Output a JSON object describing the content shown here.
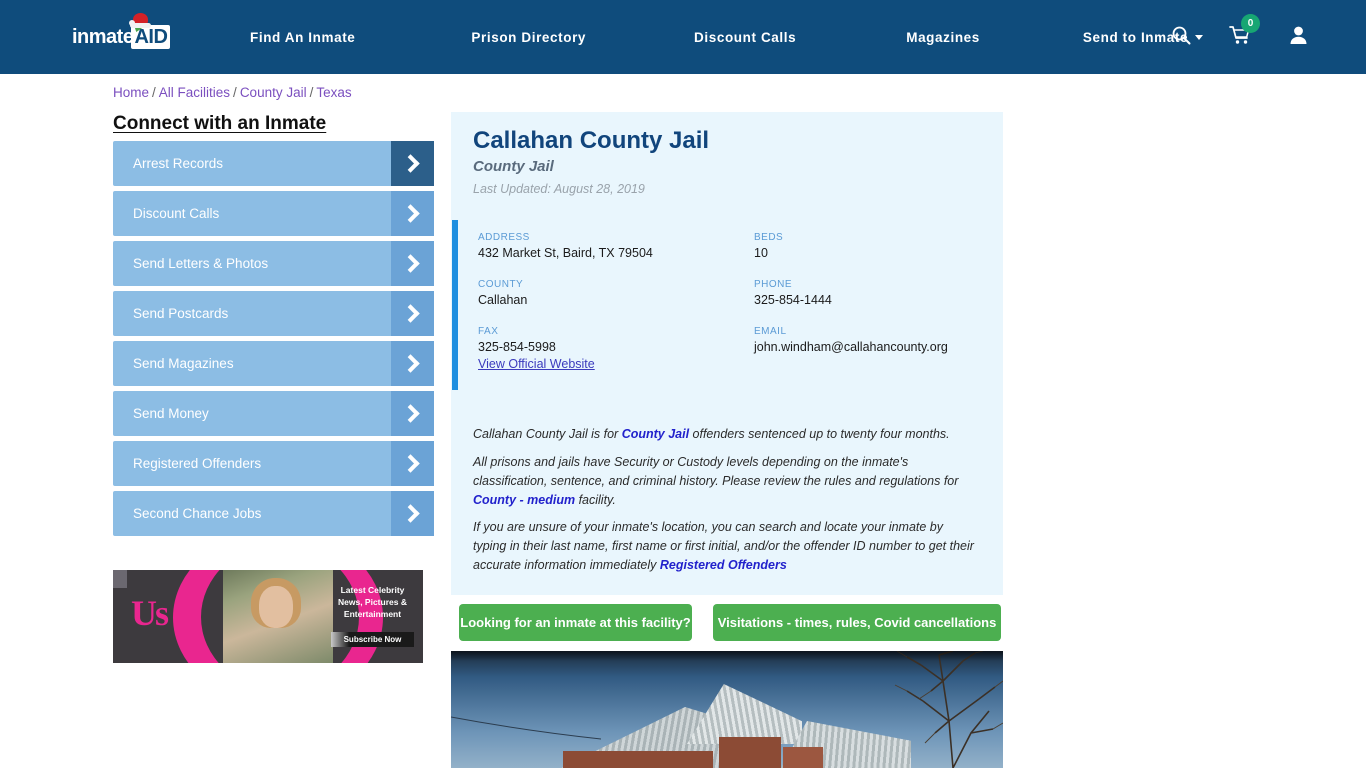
{
  "header": {
    "logo": {
      "text_primary": "inmate",
      "text_secondary": "AID",
      "icon": "santa-hat-icon"
    },
    "nav": [
      {
        "label": "Find An Inmate",
        "has_caret": false
      },
      {
        "label": "Prison Directory",
        "has_caret": false
      },
      {
        "label": "Discount Calls",
        "has_caret": false
      },
      {
        "label": "Magazines",
        "has_caret": false
      },
      {
        "label": "Send to Inmate",
        "has_caret": true
      }
    ],
    "icons": {
      "search": "search-icon",
      "cart": "cart-icon",
      "cart_badge": "0",
      "account": "user-account-icon"
    },
    "colors": {
      "bar_bg": "#0f4c7c",
      "badge_green": "#17a673"
    }
  },
  "breadcrumb": {
    "items": [
      "Home",
      "All Facilities",
      "County Jail",
      "Texas"
    ],
    "separator": "/"
  },
  "sidebar": {
    "title": "Connect with an Inmate",
    "items": [
      {
        "label": "Arrest Records",
        "active": true
      },
      {
        "label": "Discount Calls",
        "active": false
      },
      {
        "label": "Send Letters & Photos",
        "active": false
      },
      {
        "label": "Send Postcards",
        "active": false
      },
      {
        "label": "Send Magazines",
        "active": false
      },
      {
        "label": "Send Money",
        "active": false
      },
      {
        "label": "Registered Offenders",
        "active": false
      },
      {
        "label": "Second Chance Jobs",
        "active": false
      }
    ],
    "ad": {
      "brand": "Us",
      "copy": "Latest Celebrity News, Pictures & Entertainment",
      "cta": "Subscribe Now"
    }
  },
  "facility": {
    "name": "Callahan County Jail",
    "type": "County Jail",
    "last_updated": "Last Updated: August 28, 2019",
    "fields": [
      {
        "label": "ADDRESS",
        "value": "432 Market St, Baird, TX 79504"
      },
      {
        "label": "BEDS",
        "value": "10"
      },
      {
        "label": "COUNTY",
        "value": "Callahan"
      },
      {
        "label": "PHONE",
        "value": "325-854-1444"
      },
      {
        "label": "FAX",
        "value": "325-854-5998"
      },
      {
        "label": "EMAIL",
        "value": "john.windham@callahancounty.org"
      }
    ],
    "website_link": "View Official Website",
    "paragraphs": {
      "p1_before": "Callahan County Jail is for ",
      "p1_link": "County Jail",
      "p1_after": " offenders sentenced up to twenty four months.",
      "p2_before": "All prisons and jails have Security or Custody levels depending on the inmate's classification, sentence, and criminal history. Please review the rules and regulations for ",
      "p2_link": "County - medium",
      "p2_after": " facility.",
      "p3_before": "If you are unsure of your inmate's location, you can search and locate your inmate by typing in their last name, first name or first initial, and/or the offender ID number to get their accurate information immediately ",
      "p3_link": "Registered Offenders",
      "p3_after": ""
    }
  },
  "actions": {
    "find_inmate": "Looking for an inmate at this facility?",
    "visitations": "Visitations - times, rules, Covid cancellations",
    "button_color": "#4caf50"
  },
  "photo": {
    "alt": "facility-exterior-photo"
  }
}
